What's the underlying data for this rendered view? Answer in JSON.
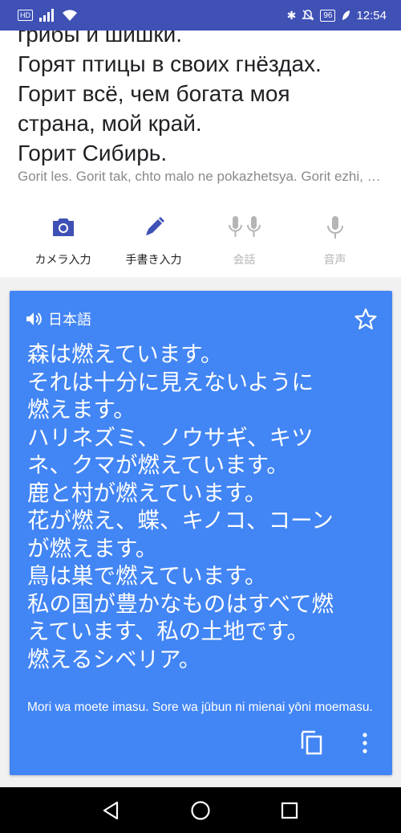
{
  "status_bar": {
    "hd": "HD",
    "battery": "96",
    "time": "12:54"
  },
  "source": {
    "lines": [
      "грибы и шишки.",
      "Горят птицы в своих гнёздах.",
      "Горит всё, чем богата моя",
      "страна, мой край.",
      "Горит Сибирь."
    ],
    "transliteration": "Gorit les.  Gorit tak, chto malo ne pokazhetsya.  Gorit ezhi, zaytsy, lisy, medvedi."
  },
  "input_tools": [
    {
      "label": "カメラ入力",
      "icon": "camera-icon",
      "enabled": true
    },
    {
      "label": "手書き入力",
      "icon": "pen-icon",
      "enabled": true
    },
    {
      "label": "会話",
      "icon": "dual-mic-icon",
      "enabled": false
    },
    {
      "label": "音声",
      "icon": "mic-icon",
      "enabled": false
    }
  ],
  "translation": {
    "language": "日本語",
    "lines": [
      "森は燃えています。",
      " それは十分に見えないように",
      "燃えます。",
      " ハリネズミ、ノウサギ、キツ",
      "ネ、クマが燃えています。",
      " 鹿と村が燃えています。",
      " 花が燃え、蝶、キノコ、コーン",
      "が燃えます。",
      " 鳥は巣で燃えています。",
      " 私の国が豊かなものはすべて燃",
      "えています、私の土地です。",
      " 燃えるシベリア。"
    ],
    "transliteration": "Mori wa moete imasu. Sore wa jūbun ni mienai yōni moemasu."
  },
  "colors": {
    "status_bar": "#3f51b5",
    "accent": "#3f51b5",
    "card": "#4285f4",
    "disabled": "#b5b5b5"
  }
}
